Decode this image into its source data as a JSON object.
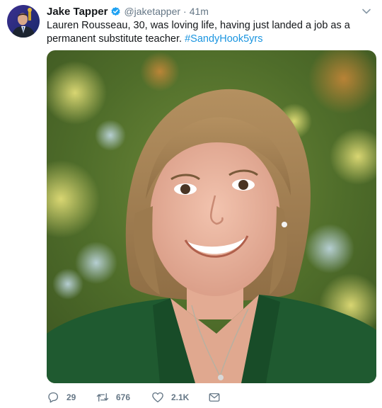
{
  "author": {
    "display_name": "Jake Tapper",
    "handle": "@jaketapper",
    "separator": "·",
    "time": "41m",
    "verified": true
  },
  "tweet": {
    "text": "Lauren Rousseau, 30, was loving life, having just landed a job as a permanent substitute teacher. ",
    "hashtag": "#SandyHook5yrs"
  },
  "actions": {
    "reply_count": "29",
    "retweet_count": "676",
    "like_count": "2.1K"
  },
  "icons": {
    "verified": "verified-badge-icon",
    "caret": "chevron-down-icon",
    "reply": "reply-icon",
    "retweet": "retweet-icon",
    "like": "heart-icon",
    "message": "direct-message-icon"
  },
  "colors": {
    "link": "#1b95e0",
    "secondary_text": "#657786",
    "verified": "#1da1f2"
  }
}
